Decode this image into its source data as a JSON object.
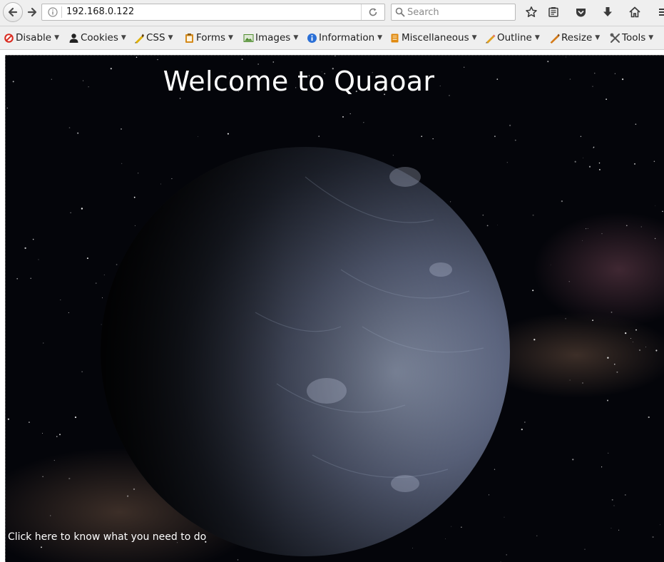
{
  "navbar": {
    "url": "192.168.0.122",
    "search_placeholder": "Search"
  },
  "devbar": {
    "items": [
      {
        "label": "Disable",
        "icon": "disable-icon",
        "color": "#d92b20"
      },
      {
        "label": "Cookies",
        "icon": "cookies-icon",
        "color": "#222222"
      },
      {
        "label": "CSS",
        "icon": "css-icon",
        "color": "#e0b000"
      },
      {
        "label": "Forms",
        "icon": "forms-icon",
        "color": "#d48a1c"
      },
      {
        "label": "Images",
        "icon": "images-icon",
        "color": "#4d8c2e"
      },
      {
        "label": "Information",
        "icon": "information-icon",
        "color": "#2a6fd6"
      },
      {
        "label": "Miscellaneous",
        "icon": "miscellaneous-icon",
        "color": "#e08a10"
      },
      {
        "label": "Outline",
        "icon": "outline-icon",
        "color": "#e0a020"
      },
      {
        "label": "Resize",
        "icon": "resize-icon",
        "color": "#d47a18"
      },
      {
        "label": "Tools",
        "icon": "tools-icon",
        "color": "#555555"
      }
    ]
  },
  "page": {
    "title": "Welcome to Quaoar",
    "link_text": "Click here to know what you need to do"
  }
}
